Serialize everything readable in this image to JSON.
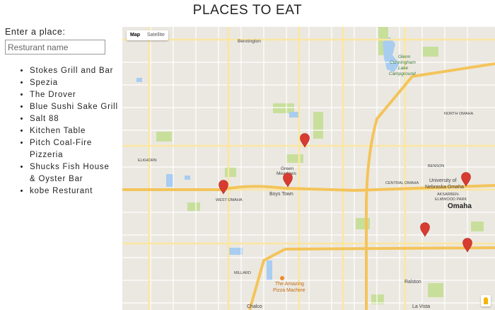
{
  "page": {
    "title": "PLACES TO EAT"
  },
  "search": {
    "label": "Enter a place:",
    "placeholder": "Resturant name"
  },
  "places": [
    "Stokes Grill and Bar",
    "Spezia",
    "The Drover",
    "Blue Sushi Sake Grill",
    "Salt 88",
    "Kitchen Table",
    "Pitch Coal-Fire Pizzeria",
    "Shucks Fish House & Oyster Bar",
    "kobe Resturant"
  ],
  "map": {
    "type_buttons": {
      "map": "Map",
      "satellite": "Satellite"
    },
    "active_type": "Map",
    "labels": {
      "bennington": "Bennington",
      "glenn": "Glenn",
      "cunningham": "Cunningham",
      "lake": "Lake",
      "campground": "Campground",
      "north_omaha": "NORTH OMAHA",
      "elkhorn": "ELKHORN",
      "green": "Green",
      "meadows": "Meadows",
      "boys_town": "Boys Town",
      "west_omaha": "WEST OMAHA",
      "benson": "BENSON",
      "central_omaha": "CENTRAL OMAHA",
      "university": "University of",
      "nebraska": "Nebraska Omaha",
      "aksarben": "AKSARBEN-",
      "elmwood": "ELMWOOD PARK",
      "omaha": "Omaha",
      "millard": "MILLARD",
      "amazing": "The Amazing",
      "pizza_machine": "Pizza Machine",
      "ralston": "Ralston",
      "la_vista": "La Vista",
      "chalco": "Chalco"
    },
    "colors": {
      "marker": "#d93b30",
      "water": "#a8cdf0",
      "park": "#c8df9c",
      "highway": "#f7d47c",
      "road": "#ffffff"
    }
  }
}
